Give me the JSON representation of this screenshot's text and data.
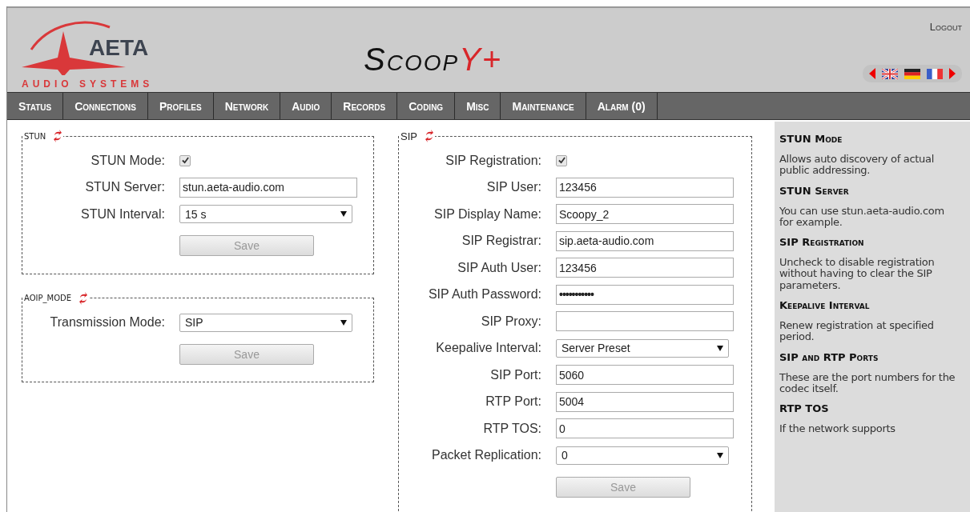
{
  "header": {
    "brand": "AETA",
    "tagline": "AUDIO SYSTEMS",
    "product": {
      "main": "Scoop",
      "accent": "Y+"
    },
    "logout": "Logout"
  },
  "nav": [
    {
      "label": "Status",
      "selected": false
    },
    {
      "label": "Connections",
      "selected": false
    },
    {
      "label": "Profiles",
      "selected": false
    },
    {
      "label": "Network",
      "selected": false
    },
    {
      "label": "Audio",
      "selected": false
    },
    {
      "label": "Records",
      "selected": false
    },
    {
      "label": "Coding",
      "selected": false
    },
    {
      "label": "Misc",
      "selected": false
    },
    {
      "label": "Maintenance",
      "selected": false
    },
    {
      "label": "Alarm (0)",
      "selected": false
    }
  ],
  "left_panels": [
    {
      "title": "STUN",
      "rows": [
        {
          "kind": "checkbox",
          "label": "STUN Mode:",
          "checked": true
        },
        {
          "kind": "text",
          "label": "STUN Server:",
          "value": "stun.aeta-audio.com"
        },
        {
          "kind": "select",
          "label": "STUN Interval:",
          "value": "15 s"
        }
      ],
      "button": {
        "label": "Save",
        "disabled": true
      }
    },
    {
      "title": "AOIP_MODE",
      "rows": [
        {
          "kind": "select",
          "label": "Transmission Mode:",
          "value": "SIP"
        }
      ],
      "button": {
        "label": "Save",
        "disabled": true
      }
    }
  ],
  "sip_panel": {
    "title": "SIP",
    "rows": [
      {
        "kind": "checkbox",
        "label": "SIP Registration:",
        "checked": true
      },
      {
        "kind": "text",
        "label": "SIP User:",
        "value": "123456"
      },
      {
        "kind": "text",
        "label": "SIP Display Name:",
        "value": "Scoopy_2"
      },
      {
        "kind": "text",
        "label": "SIP Registrar:",
        "value": "sip.aeta-audio.com"
      },
      {
        "kind": "text",
        "label": "SIP Auth User:",
        "value": "123456"
      },
      {
        "kind": "password",
        "label": "SIP Auth Password:",
        "value": "•••••••••••"
      },
      {
        "kind": "text",
        "label": "SIP Proxy:"
      },
      {
        "kind": "select",
        "label": "Keepalive Interval:",
        "value": "Server Preset"
      },
      {
        "kind": "text",
        "label": "SIP Port:",
        "value": "5060"
      },
      {
        "kind": "text",
        "label": "RTP Port:",
        "value": "5004"
      },
      {
        "kind": "text",
        "label": "RTP TOS:",
        "value": "0"
      },
      {
        "kind": "select",
        "label": "Packet Replication:",
        "value": "0"
      }
    ],
    "button": {
      "label": "Save",
      "disabled": true
    }
  },
  "help": [
    {
      "title": "STUN Mode",
      "text": "Allows auto discovery of actual public addressing."
    },
    {
      "title": "STUN Server",
      "text": "You can use stun.aeta-audio.com for example."
    },
    {
      "title": "SIP Registration",
      "text": "Uncheck to disable registration without having to clear the SIP parameters."
    },
    {
      "title": "Keepalive Interval",
      "text": "Renew registration at specified period."
    },
    {
      "title": "SIP and RTP Ports",
      "text": "These are the port numbers for the codec itself."
    },
    {
      "title": "RTP TOS",
      "text": "If the network supports"
    }
  ]
}
